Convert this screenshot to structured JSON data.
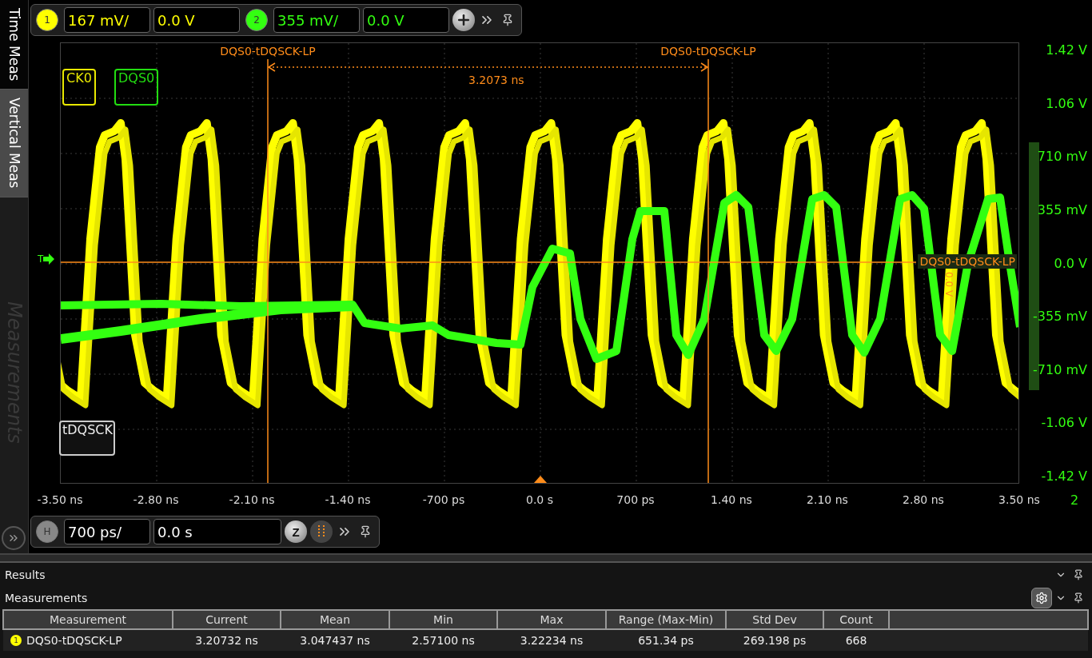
{
  "side_tabs": [
    {
      "label": "Time Meas",
      "selected": true,
      "disabled": false
    },
    {
      "label": "Vertical Meas",
      "selected": false,
      "disabled": false
    },
    {
      "label": "Measurements",
      "selected": false,
      "disabled": true
    }
  ],
  "channel_toolbar": {
    "channels": [
      {
        "number": "1",
        "scale": "167 mV/",
        "offset": "0.0 V",
        "color": "#ffff00"
      },
      {
        "number": "2",
        "scale": "355 mV/",
        "offset": "0.0 V",
        "color": "#33ff11"
      }
    ]
  },
  "plot": {
    "cursors": [
      {
        "label": "DQS0-tDQSCK-LP"
      },
      {
        "label": "DQS0-tDQSCK-LP"
      }
    ],
    "delta": "3.2073 ns",
    "channel_labels": [
      {
        "label": "CK0",
        "color": "#e8e800"
      },
      {
        "label": "DQS0",
        "color": "#22dd11"
      }
    ],
    "measurement_tag": "tDQSCK",
    "trigger_label": "T",
    "level_marker": {
      "label": "DQS0-tDQSCK-LP",
      "value": "0.0 V"
    },
    "y_labels": [
      "1.42 V",
      "1.06 V",
      "710 mV",
      "355 mV",
      "0.0 V",
      "-355 mV",
      "-710 mV",
      "-1.06 V",
      "-1.42 V"
    ],
    "x_labels": [
      "-3.50 ns",
      "-2.80 ns",
      "-2.10 ns",
      "-1.40 ns",
      "-700 ps",
      "0.0 s",
      "700 ps",
      "1.40 ns",
      "2.10 ns",
      "2.80 ns",
      "3.50 ns"
    ],
    "channel_indicator": "2"
  },
  "horizontal_toolbar": {
    "badge": "H",
    "scale": "700 ps/",
    "position": "0.0 s",
    "zoom": "Z"
  },
  "results": {
    "title": "Results",
    "section": "Measurements",
    "columns": [
      "Measurement",
      "Current",
      "Mean",
      "Min",
      "Max",
      "Range (Max-Min)",
      "Std Dev",
      "Count"
    ],
    "rows": [
      {
        "marker": "1",
        "color": "#ffff00",
        "cells": [
          "DQS0-tDQSCK-LP",
          "3.20732 ns",
          "3.047437 ns",
          "2.57100 ns",
          "3.22234 ns",
          "651.34 ps",
          "269.198 ps",
          "668"
        ]
      }
    ]
  }
}
